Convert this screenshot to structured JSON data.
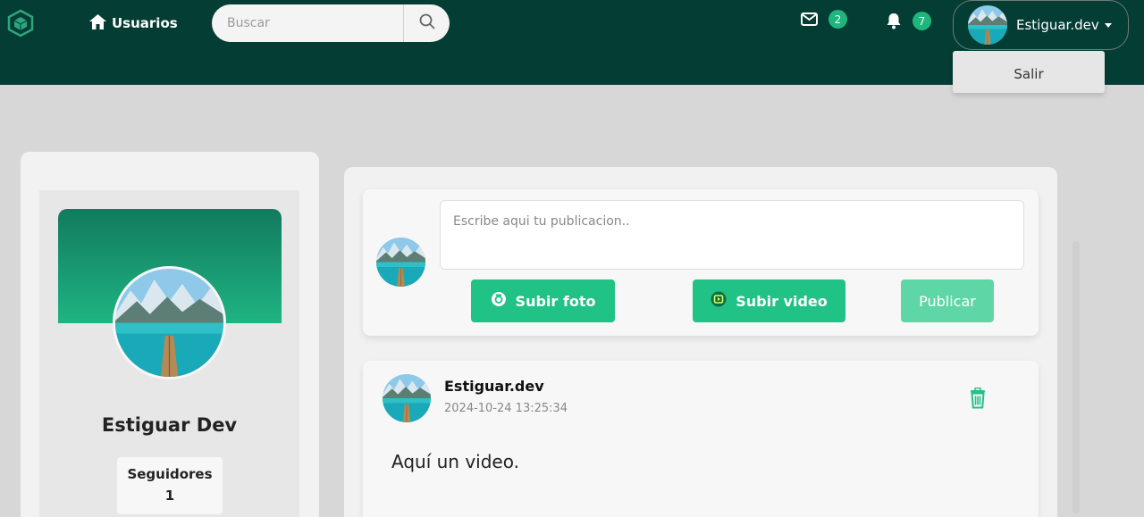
{
  "topbar": {
    "nav_users_label": "Usuarios",
    "search_placeholder": "Buscar",
    "messages_count": "2",
    "notifications_count": "7",
    "username": "Estiguar.dev",
    "dropdown_item": "Salir",
    "accent_color": "#1fb67e",
    "bg_color": "#033d33"
  },
  "profile": {
    "name": "Estiguar Dev",
    "followers_label": "Seguidores",
    "followers_count": "1"
  },
  "composer": {
    "placeholder": "Escribe aqui tu publicacion..",
    "photo_button": "Subir foto",
    "video_button": "Subir video",
    "publish_button": "Publicar"
  },
  "post": {
    "author": "Estiguar.dev",
    "date": "2024-10-24 13:25:34",
    "text": "Aquí un video."
  }
}
